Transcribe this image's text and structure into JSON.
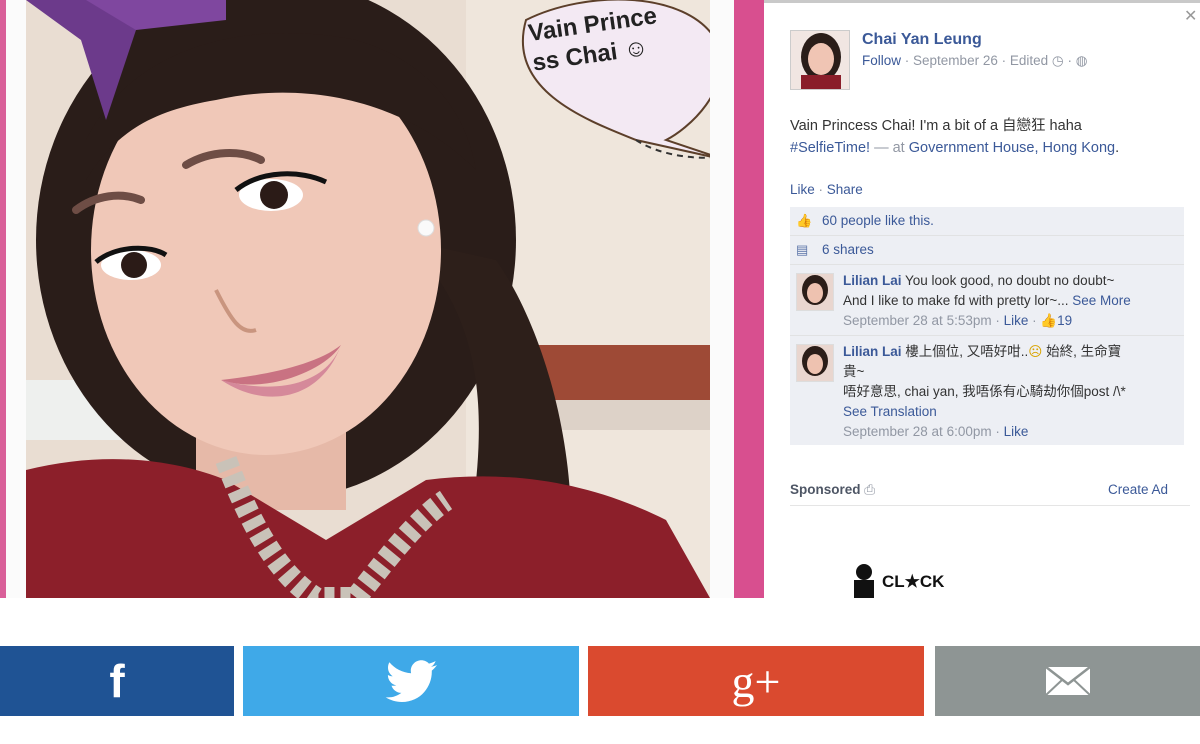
{
  "photo": {
    "sticker_text_line1": "Vain Prince",
    "sticker_text_line2": "ss Chai"
  },
  "post": {
    "author": "Chai Yan Leung",
    "follow_label": "Follow",
    "date": "September 26",
    "edited": "Edited",
    "text": "Vain Princess Chai! I'm a bit of a 自戀狂 haha",
    "hashtag": "#SelfieTime!",
    "at_prefix": " — at ",
    "location": "Government House, Hong Kong",
    "period": "."
  },
  "actions": {
    "like": "Like",
    "separator": " · ",
    "share": "Share"
  },
  "ufi": {
    "likes_text": "60 people like this.",
    "shares_text": "6 shares"
  },
  "comments": [
    {
      "name": "Lilian Lai",
      "line1": " You look good, no doubt no doubt~",
      "line2": "And I like to make fd with pretty lor~...",
      "see_more": " See More",
      "time": "September 28 at 5:53pm",
      "like": "Like",
      "like_count": "19"
    },
    {
      "name": "Lilian Lai",
      "line1": " 樓上個位, 又唔好咁..",
      "emoji": "☹",
      "line1b": " 始終, 生命寶",
      "line1c": "貴~",
      "line2": "唔好意思, chai yan, 我唔係有心騎劫你個post /\\*",
      "see_translation": "See Translation",
      "time": "September 28 at 6:00pm",
      "like": "Like"
    }
  ],
  "sidebar": {
    "sponsored": "Sponsored",
    "create_ad": "Create Ad",
    "ad_logo_text": "CL★CK"
  },
  "share_bar": {
    "facebook_label": "f",
    "twitter_icon": "twitter-bird-icon",
    "gplus_label": "g+",
    "email_icon": "envelope-icon",
    "colors": {
      "facebook": "#1f5394",
      "twitter": "#3fa9e8",
      "gplus": "#da4a2f",
      "email": "#8e9594"
    }
  }
}
